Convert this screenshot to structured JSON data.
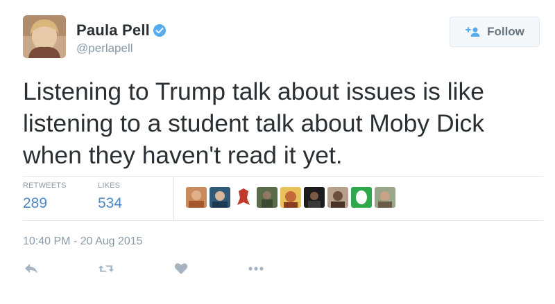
{
  "author": {
    "name": "Paula Pell",
    "handle": "@perlapell",
    "verified": true
  },
  "follow_button": {
    "label": "Follow"
  },
  "tweet": {
    "text": "Listening to Trump talk about issues is like listening to a student talk about Moby Dick when they haven't read it yet."
  },
  "stats": {
    "retweets": {
      "label": "RETWEETS",
      "value": "289"
    },
    "likes": {
      "label": "LIKES",
      "value": "534"
    }
  },
  "liker_avatars": [
    "avatar-1",
    "avatar-2",
    "avatar-3",
    "avatar-4",
    "avatar-5",
    "avatar-6",
    "avatar-7",
    "avatar-8",
    "avatar-9"
  ],
  "timestamp": "10:40 PM - 20 Aug 2015",
  "actions": [
    "reply-icon",
    "retweet-icon",
    "like-icon",
    "more-icon"
  ],
  "colors": {
    "accent": "#55acee",
    "stat_value": "#4a88c7",
    "muted": "#8899a6",
    "text": "#292f33"
  }
}
